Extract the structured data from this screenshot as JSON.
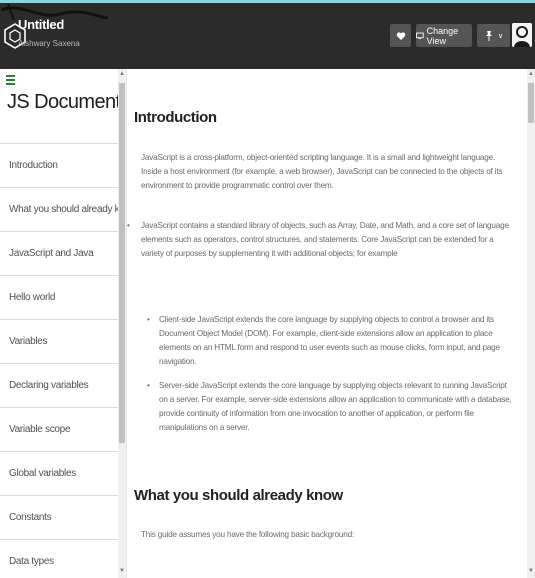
{
  "header": {
    "title": "Untitled",
    "subtitle": "Aishwary Saxena",
    "change_view_label": "Change View",
    "user_menu_caret": "∨"
  },
  "sidebar": {
    "title": "JS Documentation",
    "items": [
      {
        "label": "Introduction"
      },
      {
        "label": "What you should already know"
      },
      {
        "label": "JavaScript and Java"
      },
      {
        "label": "Hello world"
      },
      {
        "label": "Variables"
      },
      {
        "label": "Declaring variables"
      },
      {
        "label": "Variable scope"
      },
      {
        "label": "Global variables"
      },
      {
        "label": "Constants"
      },
      {
        "label": "Data types"
      }
    ]
  },
  "main": {
    "sections": [
      {
        "heading": "Introduction",
        "paragraphs": [
          "JavaScript is a cross-platform, object-oriented scripting language. It is a small and lightweight language. Inside a host environment (for example, a web browser), JavaScript can be connected to the objects of its environment to provide programmatic control over them.",
          "JavaScript contains a standard library of objects, such as Array, Date, and Math, and a core set of language elements such as operators, control structures, and statements. Core JavaScript can be extended for a variety of purposes by supplementing it with additional objects; for example"
        ],
        "bullets": [
          "Client-side JavaScript extends the core language by supplying objects to control a browser and its Document Object Model (DOM). For example, client-side extensions allow an application to place elements on an HTML form and respond to user events such as mouse clicks, form input, and page navigation.",
          "Server-side JavaScript extends the core language by supplying objects relevant to running JavaScript on a server. For example, server-side extensions allow an application to communicate with a database, provide continuity of information from one invocation to another of application, or perform file manipulations on a server."
        ]
      },
      {
        "heading": "What you should already know",
        "paragraphs": [
          "This guide assumes you have the following basic background:"
        ]
      }
    ],
    "bullet_glyph": "•",
    "stray_mark": "•"
  },
  "icons": {
    "brand": "hexagon-logo-icon",
    "like": "heart-icon",
    "view": "monitor-icon",
    "user": "pin-icon",
    "avatar": "user-avatar-icon",
    "scroll_up": "▲",
    "scroll_down": "▼"
  },
  "colors": {
    "topbar": "#2b2b2b",
    "topbar_accent": "#8fd3e0",
    "button": "#555555",
    "nav_text": "#505050",
    "body_text": "#6a6a6a",
    "heading_text": "#222222",
    "sidebar_marker": "#2e7d32"
  }
}
